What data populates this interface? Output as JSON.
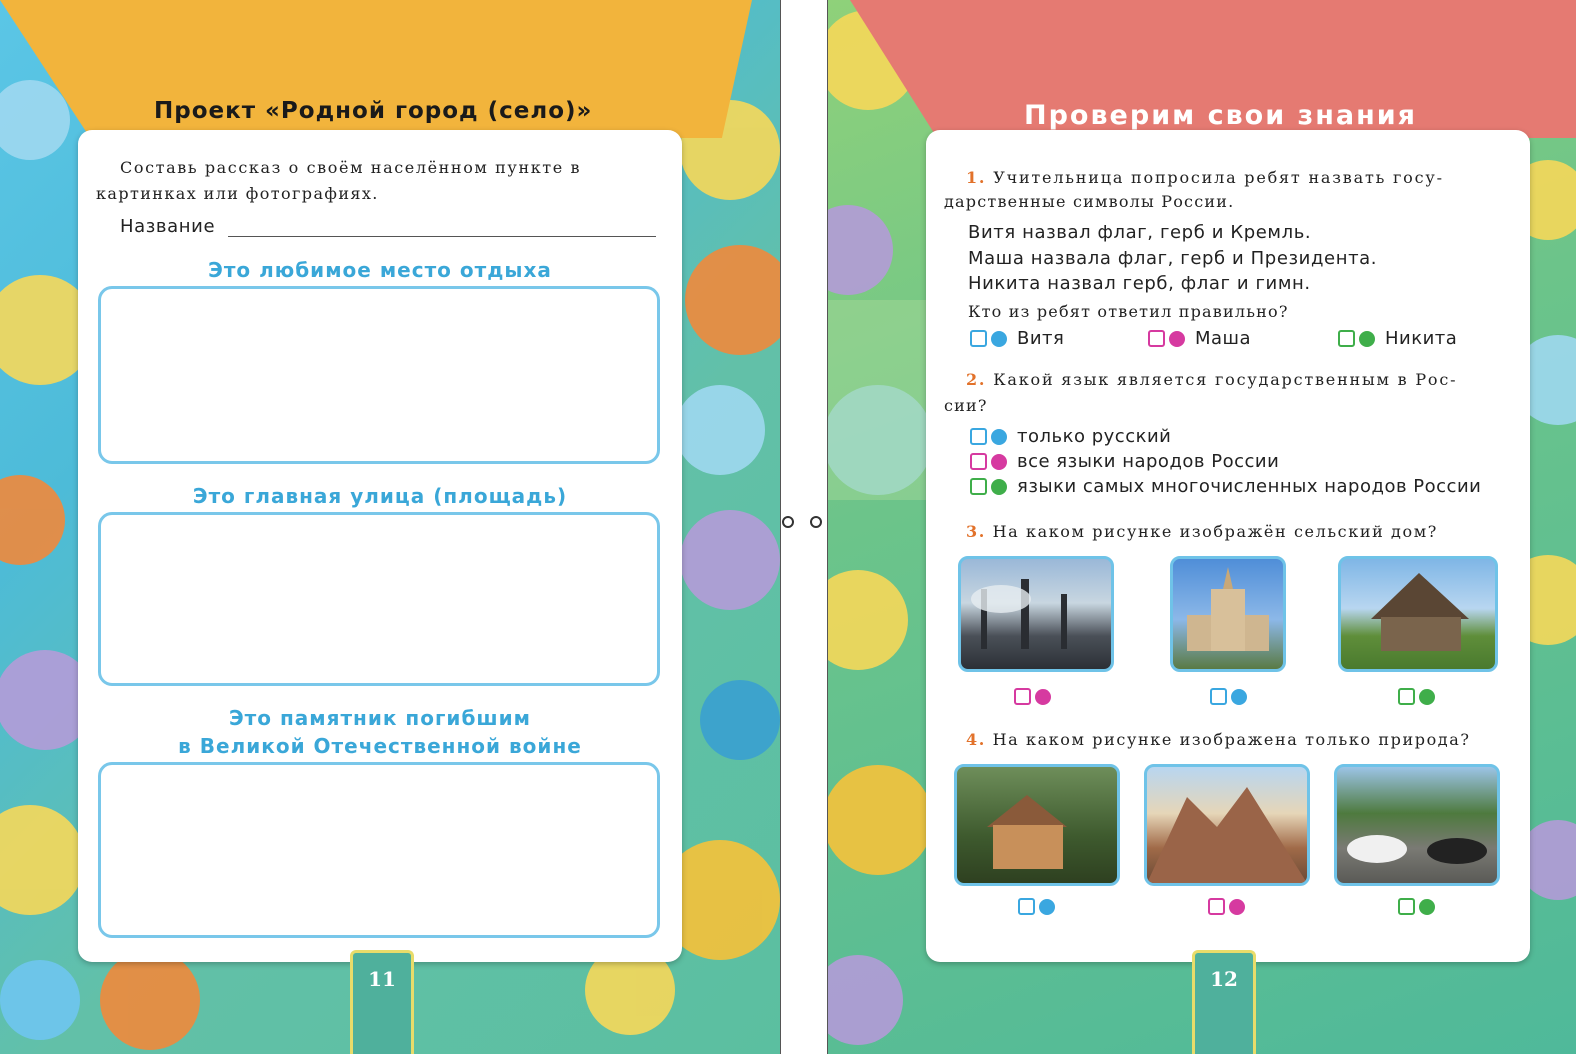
{
  "left_page": {
    "title": "Проект «Родной город (село)»",
    "intro_line1": "Составь рассказ о своём населённом пункте в",
    "intro_line2": "картинках или фотографиях.",
    "name_label": "Название",
    "section1": "Это любимое место отдыха",
    "section2": "Это главная улица (площадь)",
    "section3_line1": "Это памятник погибшим",
    "section3_line2": "в Великой Отечественной войне",
    "page_number": "11"
  },
  "right_page": {
    "title": "Проверим свои знания",
    "page_number": "12",
    "q1": {
      "number": "1.",
      "text_line1": "Учительница попросила ребят назвать госу-",
      "text_line2": "дарственные символы России.",
      "answer_a": "Витя назвал флаг, герб и Кремль.",
      "answer_b": "Маша назвала флаг, герб и Президента.",
      "answer_c": "Никита назвал герб, флаг и гимн.",
      "prompt": "Кто из ребят ответил правильно?",
      "options": [
        "Витя",
        "Маша",
        "Никита"
      ]
    },
    "q2": {
      "number": "2.",
      "text_line1": "Какой язык является государственным в Рос-",
      "text_line2": "сии?",
      "options": [
        "только русский",
        "все языки народов России",
        "языки самых многочисленных народов России"
      ]
    },
    "q3": {
      "number": "3.",
      "text": "На каком рисунке изображён сельский дом?"
    },
    "q4": {
      "number": "4.",
      "text": "На каком рисунке изображена только природа?"
    }
  },
  "colors": {
    "left_tab": "#f2b43c",
    "right_tab": "#e57a72",
    "subheading": "#3aa7d8",
    "question_number": "#e2722b",
    "option_blue": "#3aa7e0",
    "option_pink": "#d63aa0",
    "option_green": "#3fae4a"
  }
}
